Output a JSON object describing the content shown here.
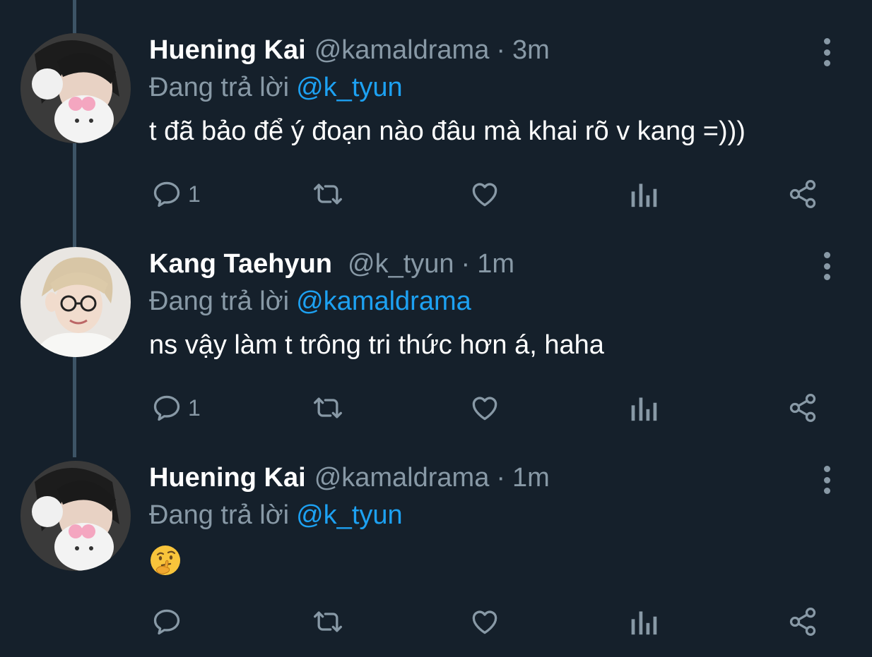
{
  "tweets": [
    {
      "name": "Huening Kai",
      "handle": "@kamaldrama",
      "dot": "·",
      "time": "3m",
      "reply_prefix": "Đang trả lời",
      "reply_to": "@k_tyun",
      "text": "t đã bảo để ý đoạn nào đâu mà khai rõ v kang =)))",
      "reply_count": "1",
      "avatar_icon": "avatar-photo"
    },
    {
      "name": "Kang Taehyun",
      "handle": "@k_tyun",
      "dot": "·",
      "time": "1m",
      "reply_prefix": "Đang trả lời",
      "reply_to": "@kamaldrama",
      "text": "ns vậy làm t trông tri thức hơn á, haha",
      "reply_count": "1",
      "avatar_icon": "avatar-photo"
    },
    {
      "name": "Huening Kai",
      "handle": "@kamaldrama",
      "dot": "·",
      "time": "1m",
      "reply_prefix": "Đang trả lời",
      "reply_to": "@k_tyun",
      "emoji": "thinking-face-emoji",
      "reply_count": "",
      "avatar_icon": "avatar-photo"
    }
  ],
  "colors": {
    "background": "#15202b",
    "name": "#ffffff",
    "muted": "#8899a6",
    "mention": "#1da1f2",
    "thread_line": "#3d5466"
  },
  "icons": [
    "reply-icon",
    "retweet-icon",
    "like-icon",
    "analytics-icon",
    "share-icon",
    "more-options-icon"
  ]
}
